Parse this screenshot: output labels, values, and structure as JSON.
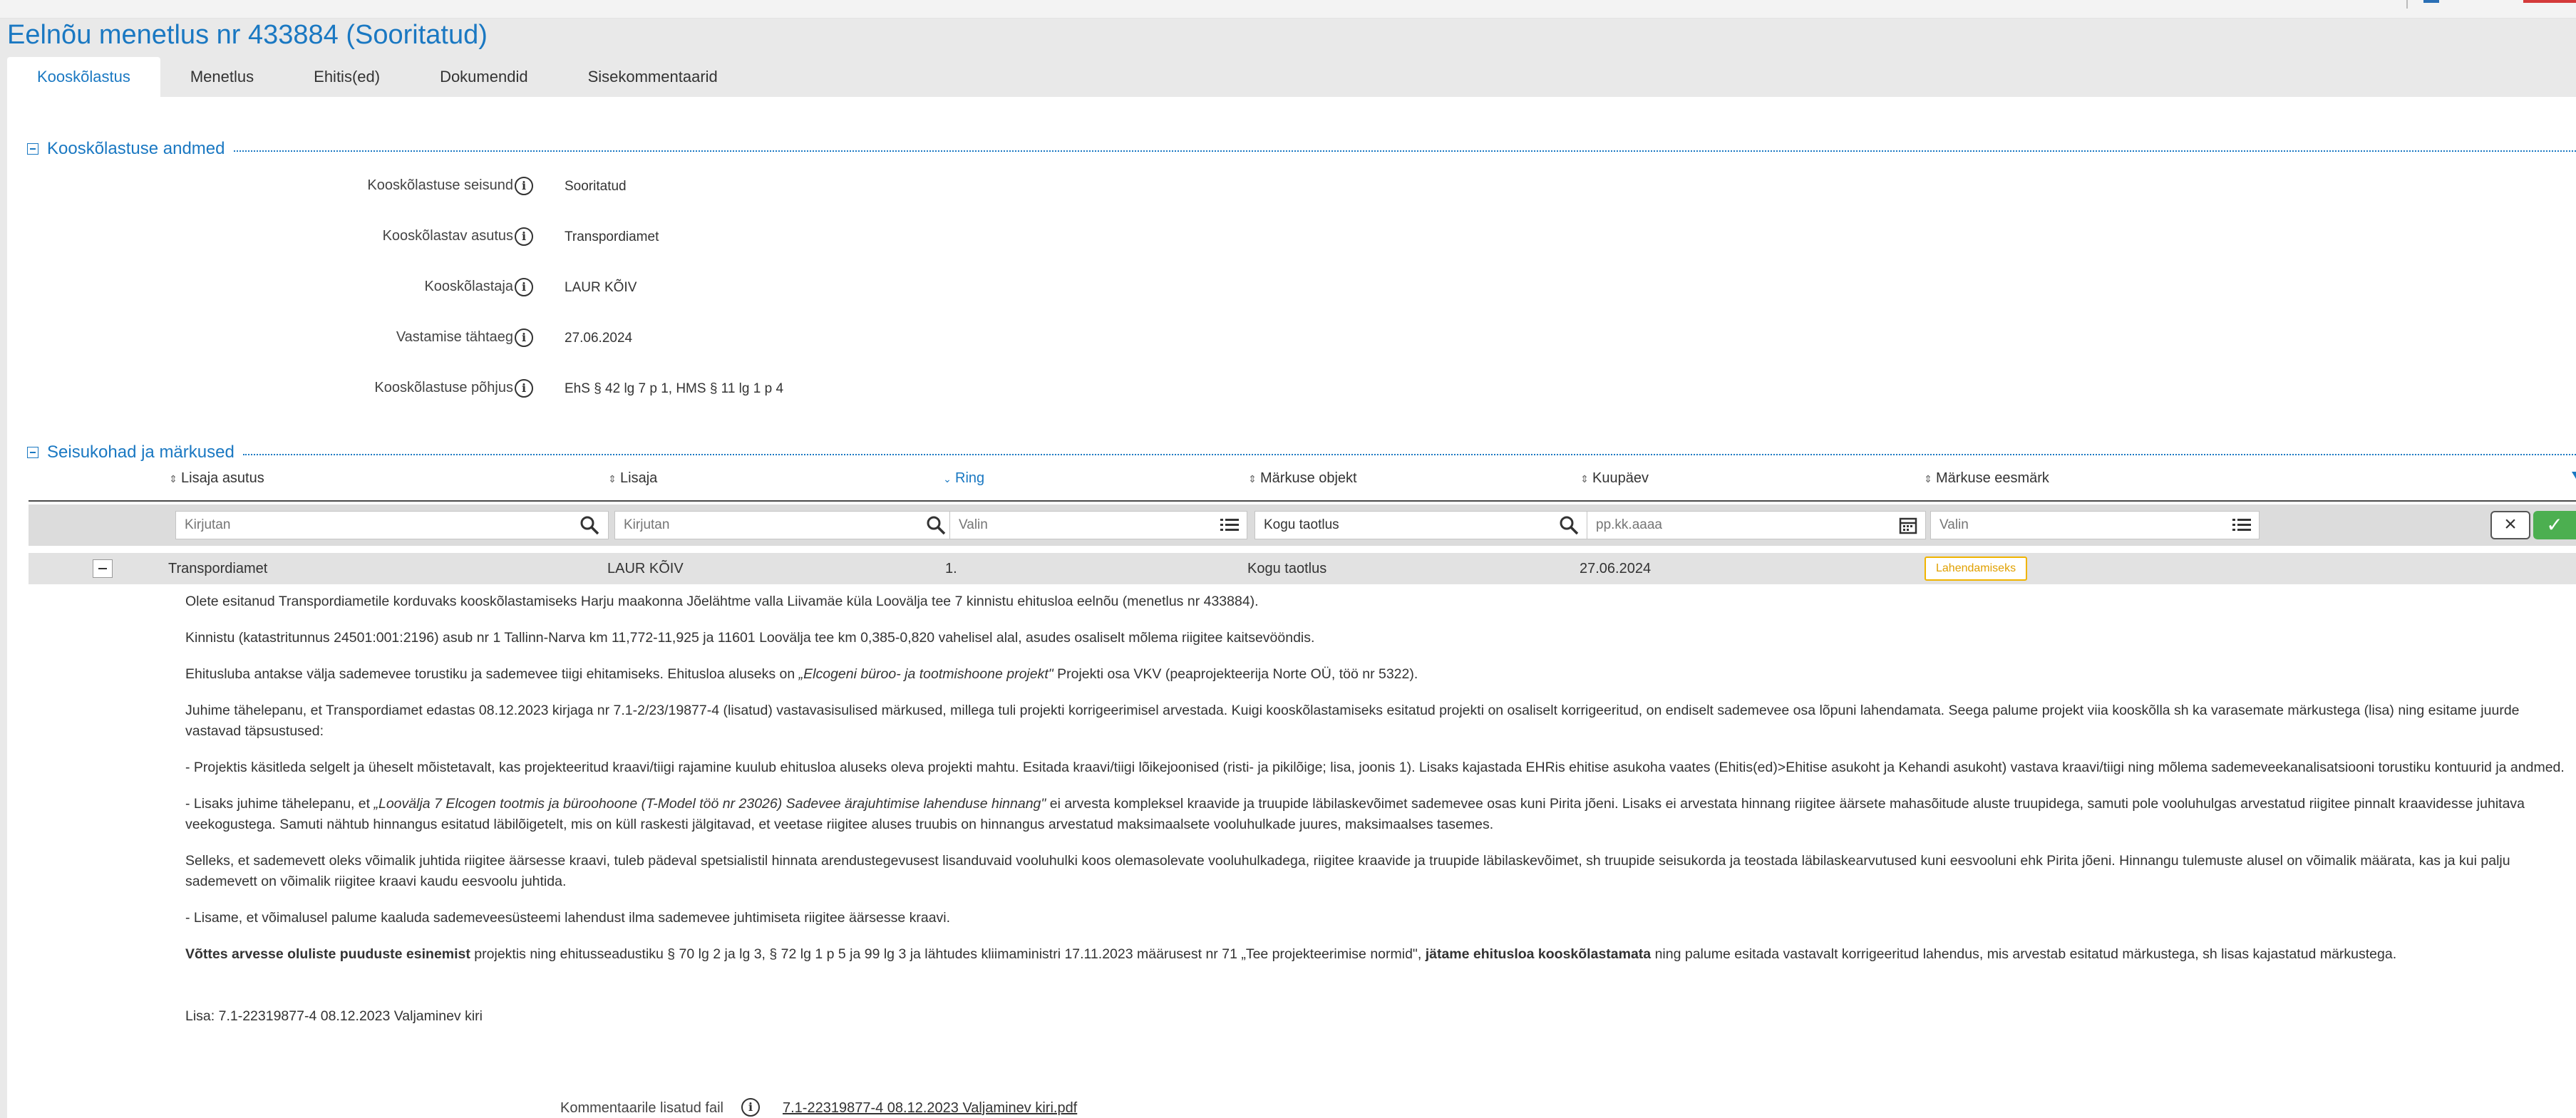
{
  "page_title": "Eelnõu menetlus nr 433884 (Sooritatud)",
  "tabs": [
    {
      "label": "Kooskõlastus"
    },
    {
      "label": "Menetlus"
    },
    {
      "label": "Ehitis(ed)"
    },
    {
      "label": "Dokumendid"
    },
    {
      "label": "Sisekommentaarid"
    }
  ],
  "section1": {
    "title": "Kooskõlastuse andmed",
    "fields": [
      {
        "label": "Kooskõlastuse seisund",
        "value": "Sooritatud"
      },
      {
        "label": "Kooskõlastav asutus",
        "value": "Transpordiamet"
      },
      {
        "label": "Kooskõlastaja",
        "value": "LAUR KÕIV"
      },
      {
        "label": "Vastamise tähtaeg",
        "value": "27.06.2024"
      },
      {
        "label": "Kooskõlastuse põhjus",
        "value": "EhS § 42 lg 7 p 1, HMS § 11 lg 1 p 4"
      }
    ]
  },
  "section2": {
    "title": "Seisukohad ja märkused",
    "columns": [
      "Lisaja asutus",
      "Lisaja",
      "Ring",
      "Märkuse objekt",
      "Kuupäev",
      "Märkuse eesmärk"
    ],
    "filters": {
      "asutus_placeholder": "Kirjutan",
      "lisaja_placeholder": "Kirjutan",
      "ring_placeholder": "Valin",
      "objekt_value": "Kogu taotlus",
      "kuupaev_placeholder": "pp.kk.aaaa",
      "eesmark_placeholder": "Valin"
    },
    "row": {
      "asutus": "Transpordiamet",
      "lisaja": "LAUR KÕIV",
      "ring": "1.",
      "objekt": "Kogu taotlus",
      "kuupaev": "27.06.2024",
      "eesmark": "Lahendamiseks"
    },
    "comment": {
      "p1": "Olete esitanud Transpordiametile korduvaks kooskõlastamiseks Harju maakonna Jõelähtme valla Liivamäe küla Loovälja tee 7 kinnistu ehitusloa eelnõu (menetlus nr 433884).",
      "p2": "Kinnistu (katastritunnus 24501:001:2196) asub nr 1 Tallinn-Narva km 11,772-11,925 ja 11601 Loovälja tee km 0,385-0,820 vahelisel alal, asudes osaliselt mõlema riigitee kaitsevööndis.",
      "p3a": "Ehitusluba antakse välja sademevee torustiku ja sademevee tiigi ehitamiseks. Ehitusloa aluseks on ",
      "p3i": "„Elcogeni büroo- ja tootmishoone projekt\"",
      "p3b": " Projekti osa VKV (peaprojekteerija Norte OÜ, töö nr 5322).",
      "p4": "Juhime tähelepanu, et Transpordiamet edastas 08.12.2023 kirjaga nr 7.1-2/23/19877-4 (lisatud) vastavasisulised märkused, millega tuli projekti korrigeerimisel arvestada. Kuigi kooskõlastamiseks esitatud projekti on osaliselt korrigeeritud, on endiselt sademevee osa lõpuni lahendamata. Seega palume projekt viia kooskõlla sh ka varasemate märkustega (lisa) ning esitame juurde vastavad täpsustused:",
      "p5": "-  Projektis käsitleda selgelt ja üheselt mõistetavalt, kas projekteeritud kraavi/tiigi rajamine kuulub ehitusloa aluseks oleva projekti mahtu. Esitada kraavi/tiigi lõikejoonised (risti- ja pikilõige; lisa, joonis 1). Lisaks kajastada EHRis ehitise asukoha vaates (Ehitis(ed)>Ehitise asukoht ja Kehandi asukoht) vastava kraavi/tiigi ning mõlema sademeveekanalisatsiooni torustiku kontuurid ja andmed.",
      "p6a": "-  Lisaks juhime tähelepanu, et ",
      "p6i": "„Loovälja 7 Elcogen tootmis ja büroohoone (T-Model töö nr 23026) Sadevee ärajuhtimise lahenduse hinnang\"",
      "p6b": " ei arvesta kompleksel kraavide ja truupide läbilaskevõimet sademevee osas kuni Pirita jõeni. Lisaks ei arvestata hinnang riigitee äärsete mahasõitude aluste truupidega, samuti pole vooluhulgas arvestatud riigitee pinnalt kraavidesse juhitava veekogustega. Samuti nähtub hinnangus esitatud läbilõigetelt, mis on küll raskesti jälgitavad, et veetase riigitee aluses truubis on hinnangus arvestatud maksimaalsete vooluhulkade juures, maksimaalses tasemes.",
      "p7": "Selleks, et sademevett oleks võimalik juhtida riigitee äärsesse kraavi, tuleb pädeval spetsialistil hinnata arendustegevusest lisanduvaid vooluhulki koos olemasolevate vooluhulkadega, riigitee kraavide ja truupide läbilaskevõimet, sh truupide seisukorda ja teostada läbilaskearvutused kuni eesvooluni ehk Pirita jõeni. Hinnangu tulemuste alusel on võimalik määrata, kas ja kui palju sademevett on võimalik riigitee kraavi kaudu eesvoolu juhtida.",
      "p8": "-  Lisame, et võimalusel palume kaaluda sademeveesüsteemi lahendust ilma sademevee juhtimiseta riigitee äärsesse kraavi.",
      "p9b1": "Võttes arvesse oluliste puuduste esinemist",
      "p9a": " projektis ning ehitusseadustiku § 70 lg 2 ja lg 3, § 72 lg 1 p 5 ja 99 lg 3 ja lähtudes kliimaministri 17.11.2023 määrusest nr 71 „Tee projekteerimise normid\", ",
      "p9b2": "jätame ehitusloa kooskõlastamata",
      "p9c": " ning palume esitada vastavalt korrigeeritud lahendus, mis arvestab esitatud märkustega, sh lisas kajastatud märkustega.",
      "lisa": "Lisa: 7.1-22319877-4 08.12.2023 Valjaminev kiri"
    },
    "attachment": {
      "label": "Kommentaarile lisatud fail",
      "file": "7.1-22319877-4 08.12.2023 Valjaminev kiri.pdf"
    }
  },
  "colors": {
    "accent": "#1a78c2",
    "badge": "#f0b400",
    "ok": "#4caf50"
  }
}
